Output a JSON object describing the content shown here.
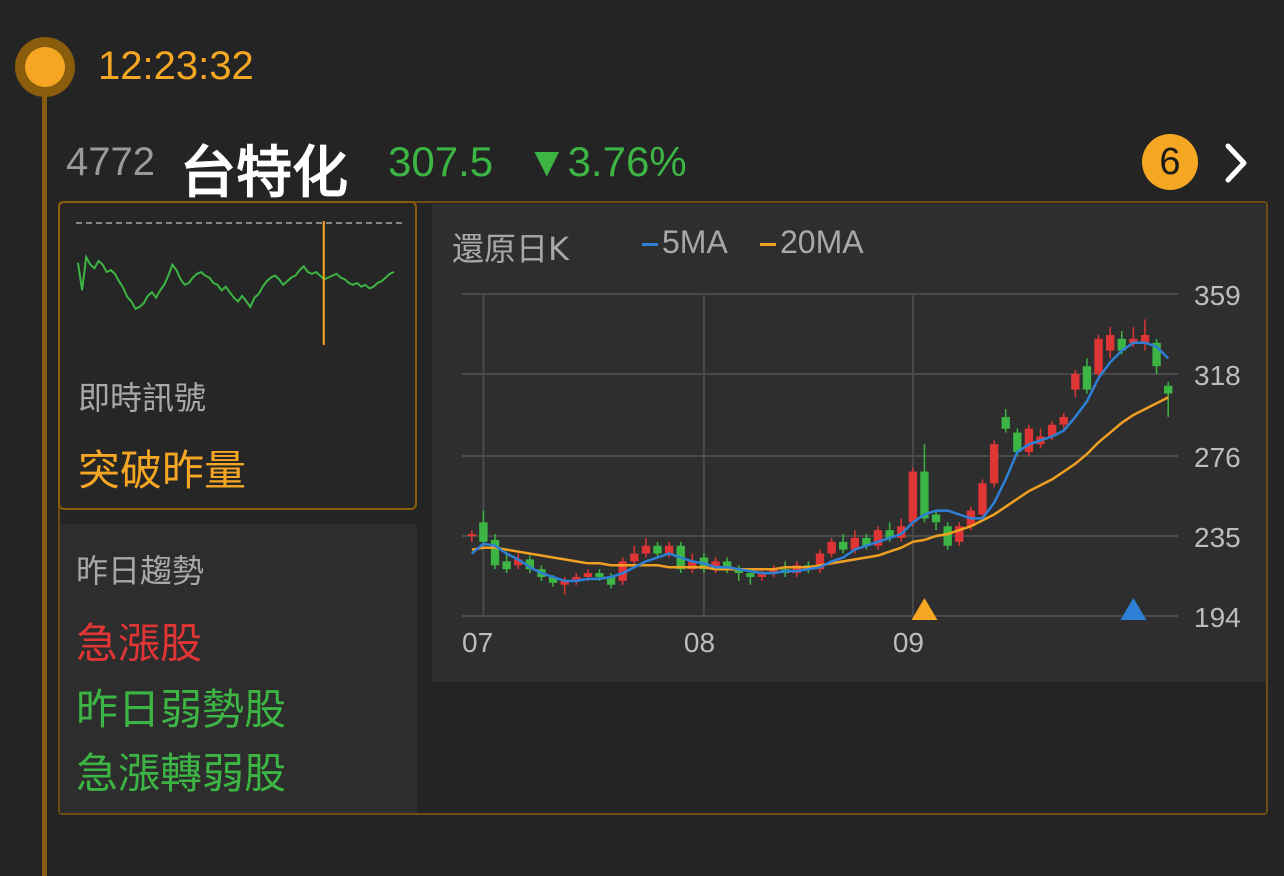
{
  "time": "12:23:32",
  "stock": {
    "code": "4772",
    "name": "台特化",
    "price": "307.5",
    "change": "▼3.76%",
    "badge_count": "6"
  },
  "signal": {
    "label": "即時訊號",
    "value": "突破昨量"
  },
  "trend": {
    "label": "昨日趨勢",
    "items": [
      {
        "text": "急漲股",
        "color": "#e03535"
      },
      {
        "text": "昨日弱勢股",
        "color": "#3cb544"
      },
      {
        "text": "急漲轉弱股",
        "color": "#3cb544"
      }
    ]
  },
  "colors": {
    "accent": "#f5a623",
    "up": "#e03535",
    "down": "#3cb544",
    "ma5": "#2e7fd6",
    "ma20": "#f0a020"
  },
  "chart_data": {
    "type": "candlestick",
    "title": "還原日K",
    "legend": [
      "5MA",
      "20MA"
    ],
    "yticks": [
      "359",
      "318",
      "276",
      "235",
      "194"
    ],
    "ylim": [
      194,
      359
    ],
    "xticks": [
      "07",
      "08",
      "09"
    ],
    "markers": [
      {
        "index": 39,
        "color": "#f5a623",
        "kind": "triangle-up"
      },
      {
        "index": 57,
        "color": "#2e7fd6",
        "kind": "triangle-up"
      }
    ],
    "candles": [
      [
        235,
        236,
        232,
        238
      ],
      [
        242,
        232,
        230,
        248
      ],
      [
        233,
        220,
        218,
        236
      ],
      [
        222,
        218,
        216,
        226
      ],
      [
        220,
        223,
        218,
        226
      ],
      [
        223,
        218,
        216,
        225
      ],
      [
        218,
        214,
        212,
        220
      ],
      [
        214,
        211,
        209,
        215
      ],
      [
        210,
        212,
        205,
        214
      ],
      [
        212,
        214,
        210,
        216
      ],
      [
        214,
        216,
        212,
        218
      ],
      [
        216,
        214,
        212,
        218
      ],
      [
        214,
        210,
        208,
        216
      ],
      [
        212,
        222,
        210,
        224
      ],
      [
        222,
        226,
        220,
        230
      ],
      [
        226,
        230,
        224,
        234
      ],
      [
        230,
        226,
        224,
        232
      ],
      [
        226,
        230,
        224,
        232
      ],
      [
        230,
        218,
        216,
        232
      ],
      [
        218,
        222,
        216,
        226
      ],
      [
        224,
        218,
        216,
        226
      ],
      [
        218,
        222,
        216,
        224
      ],
      [
        222,
        218,
        216,
        224
      ],
      [
        218,
        216,
        212,
        220
      ],
      [
        216,
        214,
        210,
        218
      ],
      [
        214,
        216,
        212,
        218
      ],
      [
        216,
        218,
        214,
        220
      ],
      [
        218,
        216,
        214,
        222
      ],
      [
        216,
        220,
        214,
        222
      ],
      [
        220,
        218,
        216,
        222
      ],
      [
        218,
        226,
        216,
        228
      ],
      [
        226,
        232,
        224,
        234
      ],
      [
        232,
        228,
        226,
        236
      ],
      [
        228,
        234,
        226,
        238
      ],
      [
        234,
        230,
        228,
        236
      ],
      [
        230,
        238,
        228,
        240
      ],
      [
        238,
        234,
        232,
        242
      ],
      [
        234,
        240,
        232,
        244
      ],
      [
        242,
        268,
        240,
        270
      ],
      [
        268,
        244,
        242,
        282
      ],
      [
        246,
        242,
        238,
        248
      ],
      [
        240,
        230,
        228,
        242
      ],
      [
        232,
        240,
        230,
        242
      ],
      [
        240,
        248,
        238,
        250
      ],
      [
        246,
        262,
        244,
        264
      ],
      [
        262,
        282,
        260,
        284
      ],
      [
        296,
        290,
        288,
        300
      ],
      [
        288,
        278,
        276,
        290
      ],
      [
        278,
        290,
        276,
        292
      ],
      [
        282,
        286,
        280,
        290
      ],
      [
        286,
        292,
        284,
        294
      ],
      [
        292,
        296,
        290,
        298
      ],
      [
        310,
        318,
        306,
        320
      ],
      [
        322,
        310,
        308,
        326
      ],
      [
        318,
        336,
        316,
        338
      ],
      [
        330,
        338,
        326,
        342
      ],
      [
        336,
        330,
        328,
        340
      ],
      [
        334,
        336,
        332,
        342
      ],
      [
        334,
        338,
        330,
        346
      ],
      [
        334,
        322,
        318,
        336
      ],
      [
        312,
        308,
        296,
        314
      ]
    ],
    "ma5": [
      226,
      231,
      230,
      226,
      223,
      219,
      216,
      214,
      212,
      212,
      213,
      213,
      214,
      216,
      219,
      222,
      224,
      226,
      224,
      222,
      221,
      219,
      219,
      218,
      217,
      216,
      216,
      217,
      217,
      218,
      219,
      222,
      224,
      228,
      230,
      232,
      234,
      236,
      242,
      246,
      248,
      248,
      246,
      244,
      244,
      252,
      264,
      278,
      282,
      284,
      286,
      289,
      296,
      304,
      316,
      324,
      330,
      334,
      334,
      332,
      326
    ],
    "ma20": [
      228,
      229,
      229,
      228,
      227,
      226,
      225,
      224,
      223,
      222,
      221,
      221,
      220,
      220,
      220,
      220,
      220,
      219,
      219,
      219,
      219,
      218,
      218,
      218,
      218,
      218,
      218,
      219,
      219,
      219,
      220,
      221,
      222,
      223,
      224,
      225,
      227,
      229,
      232,
      233,
      235,
      236,
      238,
      240,
      243,
      246,
      250,
      254,
      258,
      261,
      264,
      268,
      272,
      277,
      283,
      288,
      293,
      297,
      300,
      303,
      306
    ],
    "mini_line": [
      0.72,
      0.42,
      0.78,
      0.7,
      0.66,
      0.74,
      0.7,
      0.62,
      0.64,
      0.6,
      0.52,
      0.45,
      0.35,
      0.3,
      0.22,
      0.24,
      0.28,
      0.36,
      0.4,
      0.34,
      0.42,
      0.48,
      0.58,
      0.7,
      0.64,
      0.54,
      0.48,
      0.5,
      0.56,
      0.6,
      0.62,
      0.58,
      0.56,
      0.5,
      0.48,
      0.42,
      0.46,
      0.4,
      0.34,
      0.3,
      0.36,
      0.3,
      0.24,
      0.34,
      0.38,
      0.46,
      0.52,
      0.56,
      0.58,
      0.54,
      0.48,
      0.52,
      0.56,
      0.58,
      0.64,
      0.68,
      0.62,
      0.6,
      0.62,
      0.58,
      0.54,
      0.56,
      0.58,
      0.6,
      0.56,
      0.54,
      0.5,
      0.48,
      0.5,
      0.46,
      0.48,
      0.44,
      0.46,
      0.5,
      0.52,
      0.56,
      0.6,
      0.62
    ],
    "mini_cursor": 0.76
  }
}
